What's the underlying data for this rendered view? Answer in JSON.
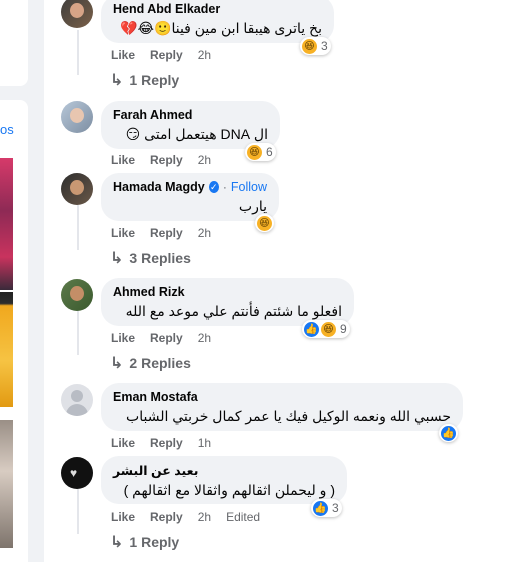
{
  "sidebar": {
    "link_text": "os"
  },
  "comments": [
    {
      "author": "Hend Abd Elkader",
      "text": "بخ ياترى هيبقا ابن مين فينا🙂😂💔",
      "reaction_count": "3",
      "like": "Like",
      "reply": "Reply",
      "time": "2h",
      "replies_label": "1 Reply"
    },
    {
      "author": "Farah Ahmed",
      "text": "ال DNA هيتعمل امتى 😏",
      "reaction_count": "6",
      "like": "Like",
      "reply": "Reply",
      "time": "2h"
    },
    {
      "author": "Hamada Magdy",
      "follow": "Follow",
      "text": "يارب",
      "like": "Like",
      "reply": "Reply",
      "time": "2h",
      "replies_label": "3 Replies"
    },
    {
      "author": "Ahmed Rizk",
      "text": "افعلو ما شئتم فأنتم علي موعد مع الله",
      "reaction_count": "9",
      "like": "Like",
      "reply": "Reply",
      "time": "2h",
      "replies_label": "2 Replies"
    },
    {
      "author": "Eman Mostafa",
      "text": "حسبي الله ونعمه الوكيل فيك يا عمر كمال خربتي الشباب",
      "like": "Like",
      "reply": "Reply",
      "time": "1h"
    },
    {
      "author": "بعيد عن البشر",
      "text": "( و ليحملن اثقالهم واثقالا مع اثقالهم )",
      "reaction_count": "3",
      "like": "Like",
      "reply": "Reply",
      "time": "2h",
      "edited": "Edited",
      "replies_label": "1 Reply"
    }
  ],
  "colors": {
    "link": "#1877f2",
    "secondary": "#65676b",
    "bubble": "#f0f2f5"
  }
}
